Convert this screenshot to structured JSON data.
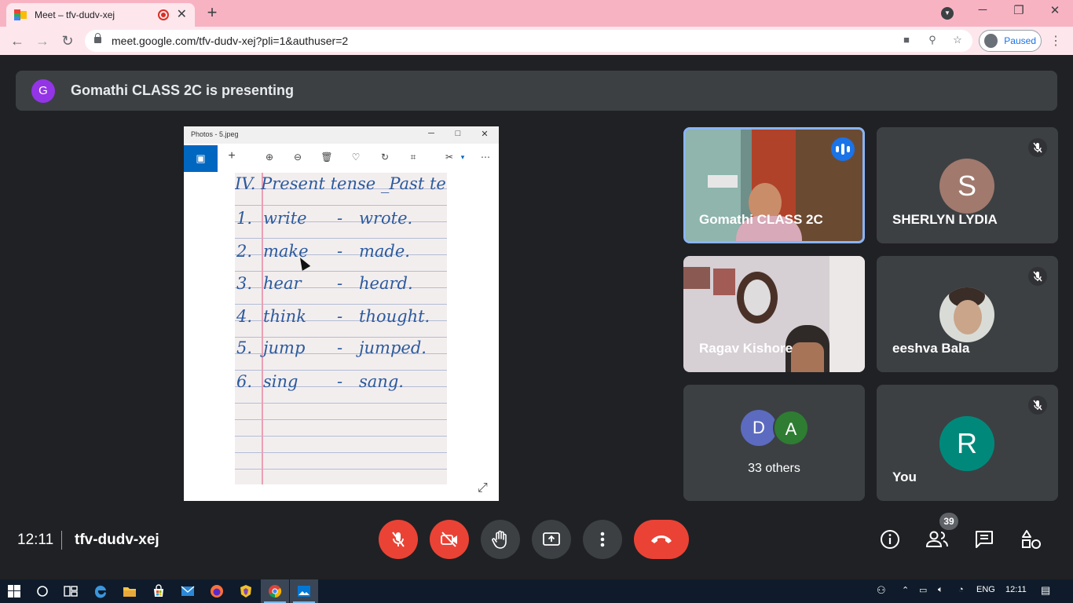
{
  "browser": {
    "tab_title": "Meet – tfv-dudv-xej",
    "url": "meet.google.com/tfv-dudv-xej?pli=1&authuser=2",
    "profile_status": "Paused",
    "accent": "#f8b3c3"
  },
  "meet": {
    "presenter_initial": "G",
    "presenting_banner": "Gomathi CLASS 2C is presenting",
    "clock": "12:11",
    "meeting_code": "tfv-dudv-xej",
    "participant_count": "39"
  },
  "photos_window": {
    "title": "Photos - 5.jpeg",
    "notebook": {
      "heading": "IV. Present tense _Past tense",
      "rows": [
        {
          "num": "1.",
          "present": "write",
          "dash": "-",
          "past": "wrote."
        },
        {
          "num": "2.",
          "present": "make",
          "dash": "-",
          "past": "made."
        },
        {
          "num": "3.",
          "present": "hear",
          "dash": "-",
          "past": "heard."
        },
        {
          "num": "4.",
          "present": "think",
          "dash": "-",
          "past": "thought."
        },
        {
          "num": "5.",
          "present": "jump",
          "dash": "-",
          "past": "jumped."
        },
        {
          "num": "6.",
          "present": "sing",
          "dash": "-",
          "past": "sang."
        }
      ]
    }
  },
  "participants": [
    {
      "name": "Gomathi CLASS 2C",
      "type": "video",
      "speaking": true
    },
    {
      "name": "SHERLYN LYDIA",
      "initial": "S",
      "avatar_color": "#a1796d",
      "muted": true
    },
    {
      "name": "Ragav Kishore",
      "type": "video"
    },
    {
      "name": "eeshva Bala",
      "type": "photo",
      "muted": true
    },
    {
      "name": "33 others",
      "initials": [
        "D",
        "A"
      ],
      "avatar_colors": [
        "#5c6bc0",
        "#2e7d32"
      ]
    },
    {
      "name": "You",
      "initial": "R",
      "avatar_color": "#00897b",
      "muted": true
    }
  ],
  "taskbar": {
    "language": "ENG",
    "time": "12:11"
  }
}
